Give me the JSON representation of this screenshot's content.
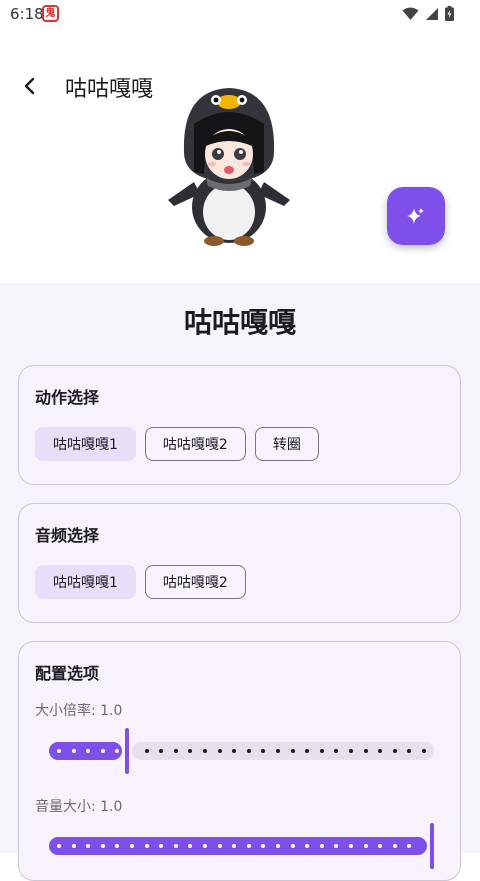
{
  "status_bar": {
    "time": "6:18",
    "app_icon_glyph": "鬼"
  },
  "top_bar": {
    "title": "咕咕嘎嘎"
  },
  "content": {
    "title": "咕咕嘎嘎"
  },
  "action_card": {
    "title": "动作选择",
    "chips": [
      {
        "label": "咕咕嘎嘎1",
        "selected": true
      },
      {
        "label": "咕咕嘎嘎2",
        "selected": false
      },
      {
        "label": "转圈",
        "selected": false
      }
    ]
  },
  "audio_card": {
    "title": "音频选择",
    "chips": [
      {
        "label": "咕咕嘎嘎1",
        "selected": true
      },
      {
        "label": "咕咕嘎嘎2",
        "selected": false
      }
    ]
  },
  "config_card": {
    "title": "配置选项",
    "size_label": "大小倍率: 1.0",
    "size_fraction": 0.2,
    "volume_label": "音量大小: 1.0",
    "volume_fraction": 1.0
  },
  "colors": {
    "accent": "#7e4fe9",
    "selected_chip": "#e8def8",
    "surface": "#f6f3fb"
  }
}
